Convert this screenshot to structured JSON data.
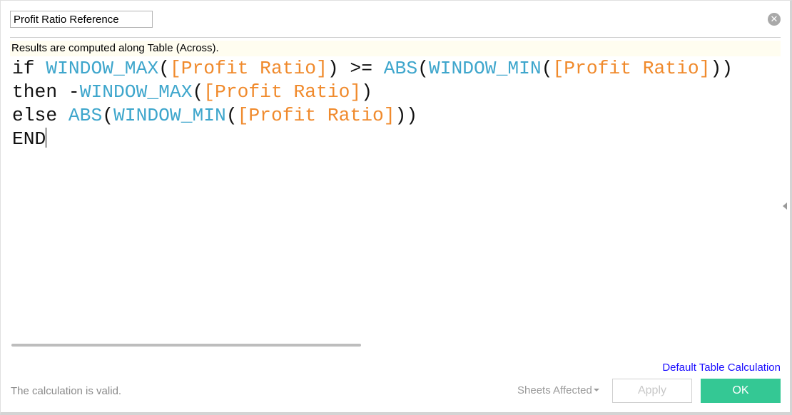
{
  "calc_name": "Profit Ratio Reference",
  "info_bar": "Results are computed along Table (Across).",
  "code": {
    "line1": {
      "kw1": "if ",
      "fn1": "WINDOW_MAX",
      "p1": "(",
      "f1": "[Profit Ratio]",
      "p2": ") >= ",
      "fn2": "ABS",
      "p3": "(",
      "fn3": "WINDOW_MIN",
      "p4": "(",
      "f2": "[Profit Ratio]",
      "p5": "))"
    },
    "line2": {
      "kw1": "then -",
      "fn1": "WINDOW_MAX",
      "p1": "(",
      "f1": "[Profit Ratio]",
      "p2": ")"
    },
    "line3": {
      "kw1": "else ",
      "fn1": "ABS",
      "p1": "(",
      "fn2": "WINDOW_MIN",
      "p2": "(",
      "f1": "[Profit Ratio]",
      "p3": "))"
    },
    "line4": {
      "kw1": "END"
    }
  },
  "colors": {
    "function": "#3ea6cc",
    "field": "#f08a2c",
    "ok": "#34c894",
    "link": "#1a0dff"
  },
  "footer": {
    "default_table_calc": "Default Table Calculation",
    "status": "The calculation is valid.",
    "sheets_affected": "Sheets Affected",
    "apply": "Apply",
    "ok": "OK"
  },
  "icons": {
    "close": "close-circle-icon",
    "collapse": "chevron-left-icon"
  }
}
